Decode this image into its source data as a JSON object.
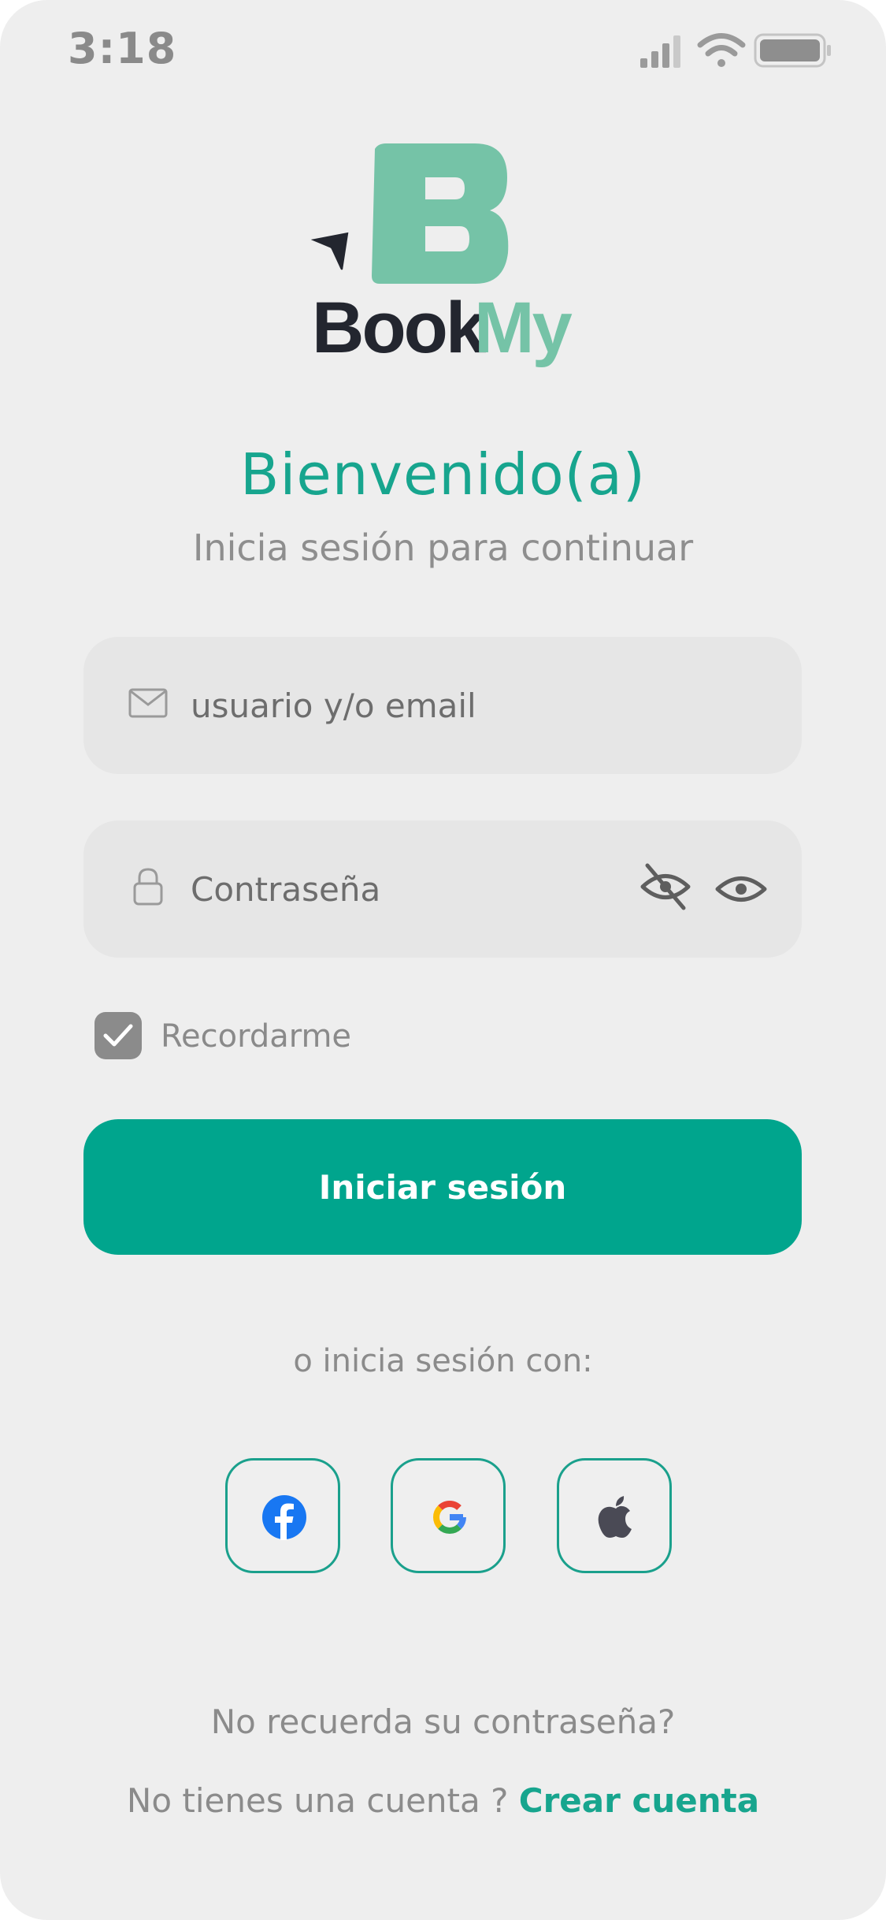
{
  "status_bar": {
    "time": "3:18",
    "signal_icon": "signal-bars-icon",
    "wifi_icon": "wifi-icon",
    "battery_icon": "battery-icon"
  },
  "brand": {
    "name_part1": "Book",
    "name_part2": "My",
    "logo_letter": "B",
    "logo_icon": "cursor-arrow-icon",
    "primary_color": "#17a58e",
    "logo_color": "#75c3a7",
    "dark_color": "#23262f"
  },
  "header": {
    "title": "Bienvenido(a)",
    "subtitle": "Inicia sesión para continuar"
  },
  "form": {
    "email": {
      "placeholder": "usuario y/o email",
      "value": "",
      "icon": "mail-icon"
    },
    "password": {
      "placeholder": "Contraseña",
      "value": "",
      "icon": "lock-icon",
      "hide_icon": "eye-off-icon",
      "show_icon": "eye-icon"
    },
    "remember": {
      "label": "Recordarme",
      "checked": true
    },
    "submit_label": "Iniciar sesión"
  },
  "social_login": {
    "label": "o inicia sesión con:",
    "providers": [
      {
        "name": "Facebook",
        "icon": "facebook-icon"
      },
      {
        "name": "Google",
        "icon": "google-icon"
      },
      {
        "name": "Apple",
        "icon": "apple-icon"
      }
    ]
  },
  "footer": {
    "forgot_password": "No recuerda su contraseña?",
    "no_account": "No tienes una cuenta ? ",
    "create_account": "Crear cuenta"
  }
}
